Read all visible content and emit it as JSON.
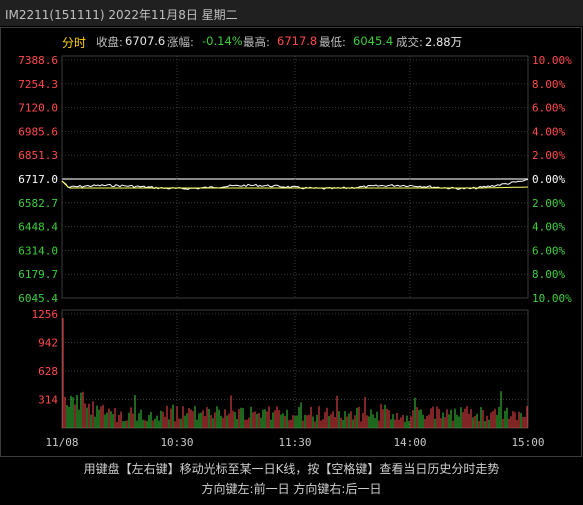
{
  "window": {
    "title": "IM2211(151111) 2022年11月8日 星期二"
  },
  "header": {
    "mode": "分时",
    "close_label": "收盘:",
    "close_value": "6707.6",
    "change_label": "涨幅:",
    "change_value": "-0.14%",
    "high_label": "最高:",
    "high_value": "6717.8",
    "low_label": "最低:",
    "low_value": "6045.4",
    "volume_label": "成交:",
    "volume_value": "2.88万"
  },
  "colors": {
    "up": "#ff4a4a",
    "down": "#3ccf3c",
    "price_line": "#ffffff",
    "avg_line": "#ffff66",
    "mode": "#ffd000"
  },
  "chart_data": [
    {
      "type": "line",
      "title": "",
      "price_ticks_left": [
        "7388.6",
        "7254.3",
        "7120.0",
        "6985.6",
        "6851.3",
        "6717.0",
        "6582.7",
        "6448.4",
        "6314.0",
        "6179.7",
        "6045.4"
      ],
      "pct_ticks_right": [
        "10.00%",
        "8.00%",
        "6.00%",
        "4.00%",
        "2.00%",
        "0.00%",
        "2.00%",
        "4.00%",
        "6.00%",
        "8.00%",
        "10.00%"
      ],
      "ylim": [
        6045.4,
        7388.6
      ],
      "reference_price": 6717.0,
      "series": []
    },
    {
      "type": "bar",
      "title": "",
      "volume_ticks": [
        "1256",
        "942",
        "628",
        "314"
      ],
      "ylim": [
        0,
        1256
      ]
    }
  ],
  "x_axis": {
    "time_ticks": [
      "11/08",
      "10:30",
      "11:30",
      "14:00",
      "15:00"
    ]
  },
  "footer": {
    "line1": "用键盘【左右键】移动光标至某一日K线，按【空格键】查看当日历史分时走势",
    "line2": "方向键左:前一日   方向键右:后一日"
  }
}
